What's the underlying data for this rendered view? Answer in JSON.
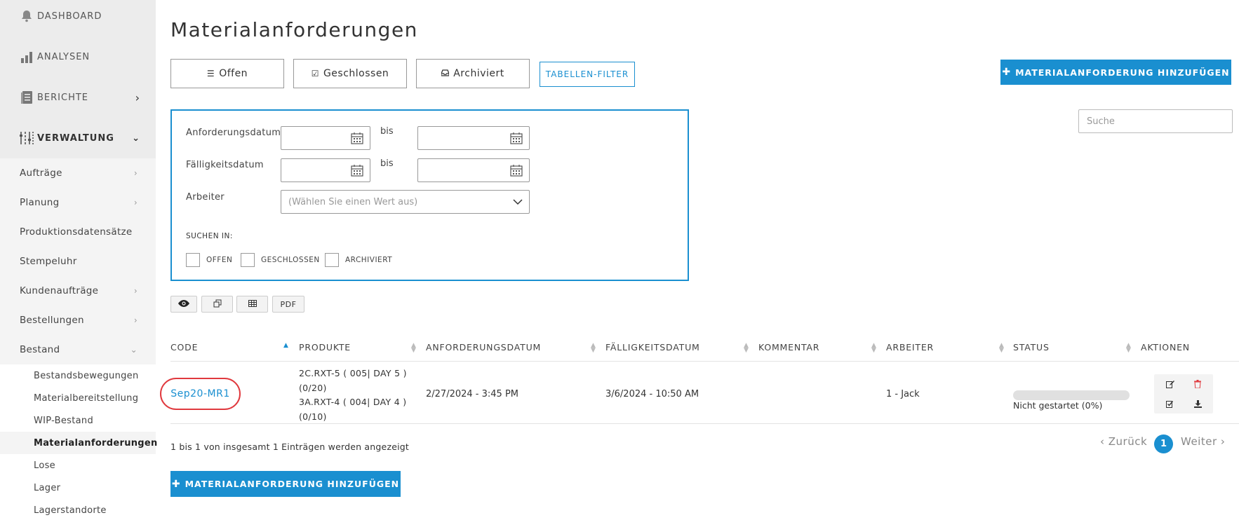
{
  "sidebar": {
    "main": [
      {
        "label": "DASHBOARD",
        "icon": "bell-icon"
      },
      {
        "label": "ANALYSEN",
        "icon": "bar-chart-icon"
      },
      {
        "label": "BERICHTE",
        "icon": "report-icon"
      },
      {
        "label": "VERWALTUNG",
        "icon": "sliders-icon"
      }
    ],
    "sub": [
      "Aufträge",
      "Planung",
      "Produktionsdatensätze",
      "Stempeluhr",
      "Kundenaufträge",
      "Bestellungen",
      "Bestand"
    ],
    "inventory": [
      "Bestandsbewegungen",
      "Materialbereitstellung",
      "WIP-Bestand",
      "Materialanforderungen",
      "Lose",
      "Lager",
      "Lagerstandorte"
    ]
  },
  "page": {
    "title": "Materialanforderungen",
    "tabs": [
      {
        "label": "Offen",
        "icon": "list-icon"
      },
      {
        "label": "Geschlossen",
        "icon": "check-square-icon"
      },
      {
        "label": "Archiviert",
        "icon": "inbox-icon"
      }
    ],
    "filter_button": "TABELLEN-FILTER",
    "add_button": "MATERIALANFORDERUNG HINZUFÜGEN",
    "search_placeholder": "Suche"
  },
  "filter": {
    "request_date_label": "Anforderungsdatum",
    "due_date_label": "Fälligkeitsdatum",
    "to_label": "bis",
    "worker_label": "Arbeiter",
    "worker_placeholder": "(Wählen Sie einen Wert aus)",
    "search_in_label": "SUCHEN IN:",
    "checkboxes": [
      "OFFEN",
      "GESCHLOSSEN",
      "ARCHIVIERT"
    ]
  },
  "toolbar": {
    "pdf_label": "PDF"
  },
  "table": {
    "headers": [
      "CODE",
      "PRODUKTE",
      "ANFORDERUNGSDATUM",
      "FÄLLIGKEITSDATUM",
      "KOMMENTAR",
      "ARBEITER",
      "STATUS",
      "AKTIONEN"
    ],
    "rows": [
      {
        "code": "Sep20-MR1",
        "products": [
          "2C.RXT-5 ( 005| DAY 5 )",
          "(0/20)",
          "3A.RXT-4 ( 004| DAY 4 )",
          "(0/10)"
        ],
        "request_date": "2/27/2024 - 3:45 PM",
        "due_date": "3/6/2024 - 10:50 AM",
        "comment": "",
        "worker": "1 - Jack",
        "status": "Nicht gestartet (0%)",
        "progress": 0
      }
    ]
  },
  "footer": {
    "info": "1 bis 1 von insgesamt 1 Einträgen werden angezeigt",
    "prev": "‹ Zurück",
    "page": "1",
    "next": "Weiter ›"
  },
  "colors": {
    "accent": "#1a8fd0",
    "highlight": "#e0393e",
    "delete": "#e0393e"
  }
}
